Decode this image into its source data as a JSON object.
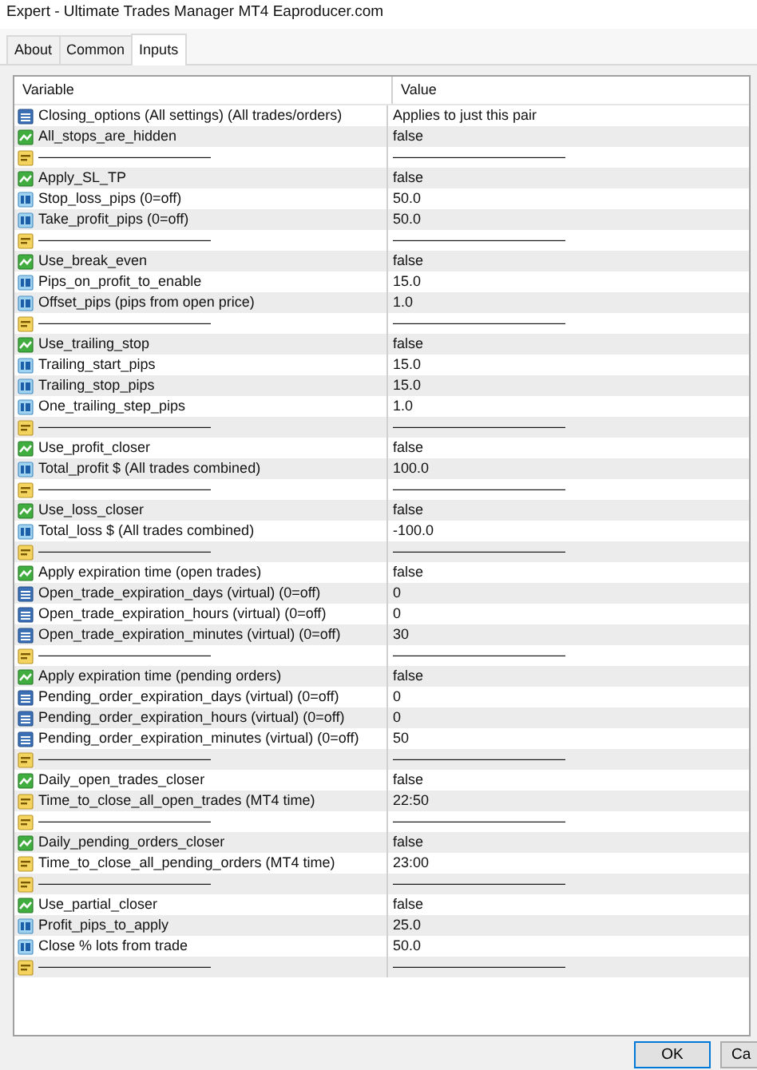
{
  "window": {
    "title": "Expert - Ultimate Trades Manager MT4 Eaproducer.com"
  },
  "tabs": [
    {
      "label": "About",
      "selected": false
    },
    {
      "label": "Common",
      "selected": false
    },
    {
      "label": "Inputs",
      "selected": true
    }
  ],
  "table": {
    "columns": [
      "Variable",
      "Value"
    ],
    "rows": [
      {
        "kind": "enum",
        "variable": "Closing_options (All settings) (All trades/orders)",
        "value": "Applies to just this pair"
      },
      {
        "kind": "bool",
        "variable": "All_stops_are_hidden",
        "value": "false"
      },
      {
        "kind": "string",
        "variable": "————————————",
        "value": "————————————"
      },
      {
        "kind": "bool",
        "variable": "Apply_SL_TP",
        "value": "false"
      },
      {
        "kind": "double",
        "variable": "Stop_loss_pips (0=off)",
        "value": "50.0"
      },
      {
        "kind": "double",
        "variable": "Take_profit_pips (0=off)",
        "value": "50.0"
      },
      {
        "kind": "string",
        "variable": "————————————",
        "value": "————————————"
      },
      {
        "kind": "bool",
        "variable": "Use_break_even",
        "value": "false"
      },
      {
        "kind": "double",
        "variable": "Pips_on_profit_to_enable",
        "value": "15.0"
      },
      {
        "kind": "double",
        "variable": "Offset_pips (pips from open price)",
        "value": "1.0"
      },
      {
        "kind": "string",
        "variable": "————————————",
        "value": "————————————"
      },
      {
        "kind": "bool",
        "variable": "Use_trailing_stop",
        "value": "false"
      },
      {
        "kind": "double",
        "variable": "Trailing_start_pips",
        "value": "15.0"
      },
      {
        "kind": "double",
        "variable": "Trailing_stop_pips",
        "value": "15.0"
      },
      {
        "kind": "double",
        "variable": "One_trailing_step_pips",
        "value": "1.0"
      },
      {
        "kind": "string",
        "variable": "————————————",
        "value": "————————————"
      },
      {
        "kind": "bool",
        "variable": "Use_profit_closer",
        "value": "false"
      },
      {
        "kind": "double",
        "variable": "Total_profit $ (All trades combined)",
        "value": "100.0"
      },
      {
        "kind": "string",
        "variable": "————————————",
        "value": "————————————"
      },
      {
        "kind": "bool",
        "variable": "Use_loss_closer",
        "value": "false"
      },
      {
        "kind": "double",
        "variable": "Total_loss $ (All trades combined)",
        "value": "-100.0"
      },
      {
        "kind": "string",
        "variable": "————————————",
        "value": "————————————"
      },
      {
        "kind": "bool",
        "variable": "Apply expiration time (open trades)",
        "value": "false"
      },
      {
        "kind": "int",
        "variable": "Open_trade_expiration_days (virtual) (0=off)",
        "value": "0"
      },
      {
        "kind": "int",
        "variable": "Open_trade_expiration_hours (virtual) (0=off)",
        "value": "0"
      },
      {
        "kind": "int",
        "variable": "Open_trade_expiration_minutes (virtual) (0=off)",
        "value": "30"
      },
      {
        "kind": "string",
        "variable": "————————————",
        "value": "————————————"
      },
      {
        "kind": "bool",
        "variable": "Apply expiration time (pending orders)",
        "value": "false"
      },
      {
        "kind": "int",
        "variable": "Pending_order_expiration_days (virtual) (0=off)",
        "value": "0"
      },
      {
        "kind": "int",
        "variable": "Pending_order_expiration_hours (virtual) (0=off)",
        "value": "0"
      },
      {
        "kind": "int",
        "variable": "Pending_order_expiration_minutes  (virtual) (0=off)",
        "value": "50"
      },
      {
        "kind": "string",
        "variable": "————————————",
        "value": "————————————"
      },
      {
        "kind": "bool",
        "variable": "Daily_open_trades_closer",
        "value": "false"
      },
      {
        "kind": "string",
        "variable": "Time_to_close_all_open_trades (MT4 time)",
        "value": "22:50"
      },
      {
        "kind": "string",
        "variable": "————————————",
        "value": "————————————"
      },
      {
        "kind": "bool",
        "variable": "Daily_pending_orders_closer",
        "value": "false"
      },
      {
        "kind": "string",
        "variable": "Time_to_close_all_pending_orders (MT4 time)",
        "value": "23:00"
      },
      {
        "kind": "string",
        "variable": "————————————",
        "value": "————————————"
      },
      {
        "kind": "bool",
        "variable": "Use_partial_closer",
        "value": "false"
      },
      {
        "kind": "double",
        "variable": "Profit_pips_to_apply",
        "value": "25.0"
      },
      {
        "kind": "double",
        "variable": "Close % lots from trade",
        "value": "50.0"
      },
      {
        "kind": "string",
        "variable": "————————————",
        "value": "————————————"
      }
    ]
  },
  "buttons": [
    "OK",
    "Ca"
  ]
}
